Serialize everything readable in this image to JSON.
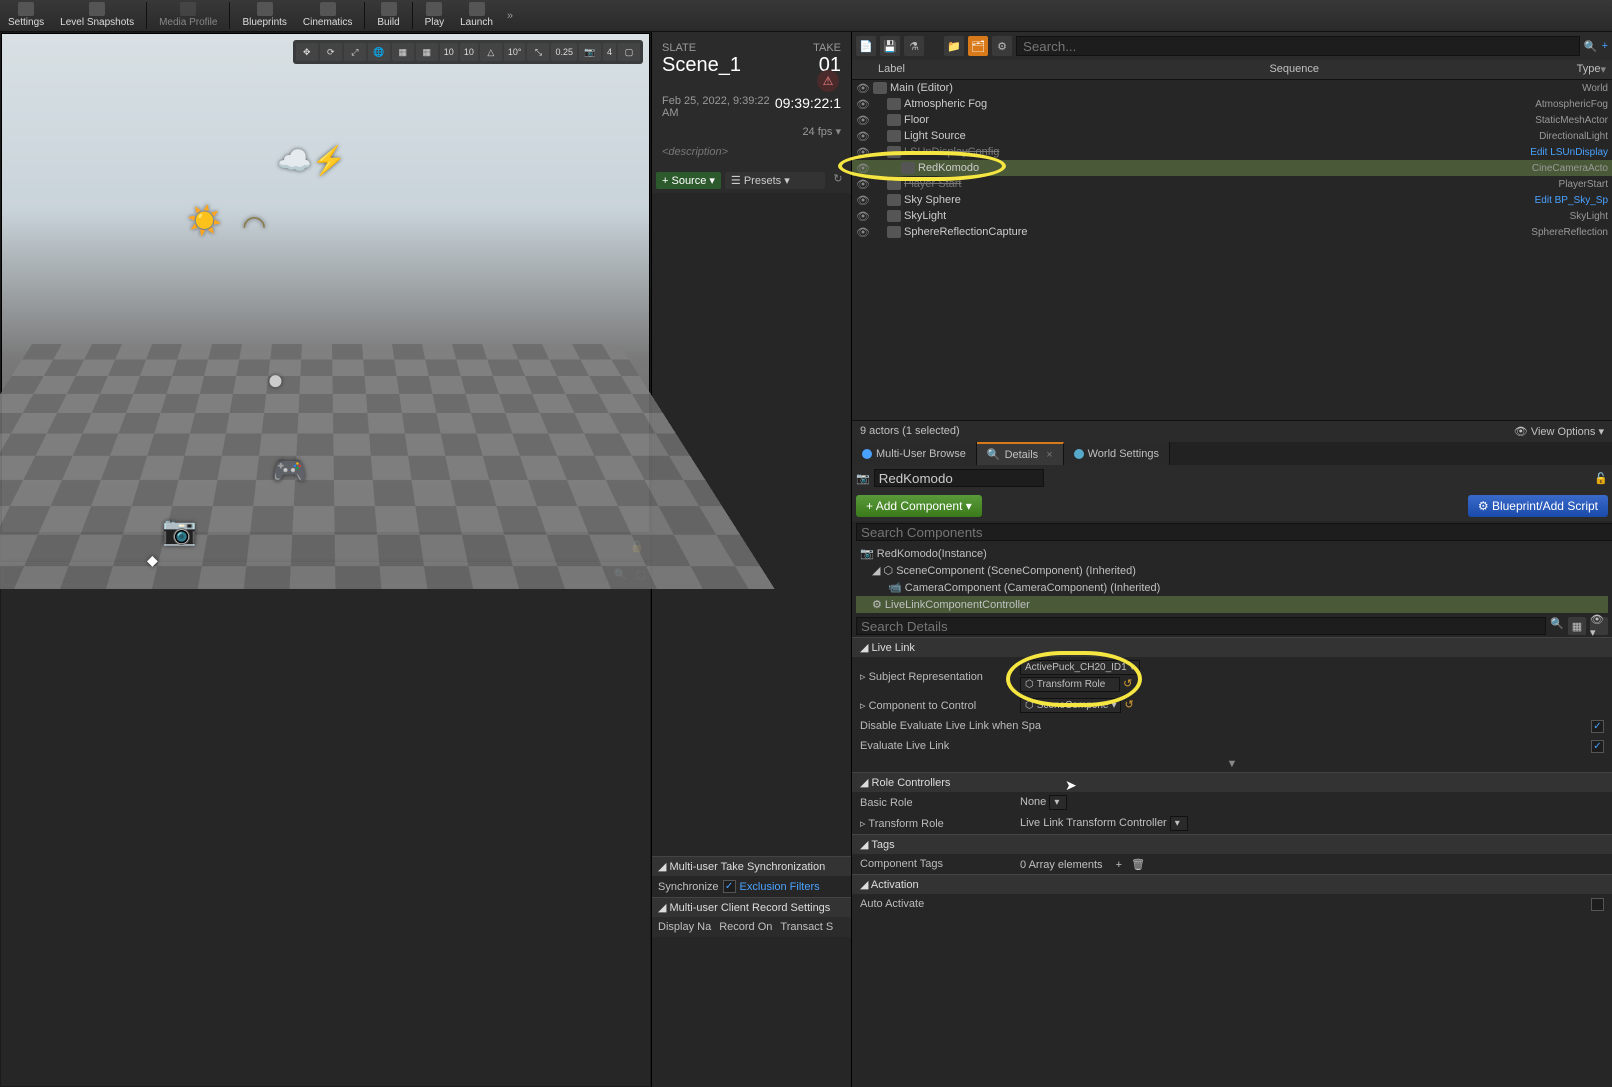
{
  "toolbar": {
    "settings": "Settings",
    "snapshots": "Level Snapshots",
    "media": "Media Profile",
    "blueprints": "Blueprints",
    "cinematics": "Cinematics",
    "build": "Build",
    "play": "Play",
    "launch": "Launch"
  },
  "viewport": {
    "snap1": "10",
    "snap2": "10",
    "snap3": "10°",
    "snap4": "0.25",
    "snap5": "4"
  },
  "slate": {
    "slate_label": "SLATE",
    "take_label": "TAKE",
    "scene": "Scene_1",
    "take": "01",
    "timestamp_text": "Feb 25, 2022, 9:39:22 AM",
    "timecode": "09:39:22:1",
    "fps": "24 fps",
    "description": "<description>",
    "source_btn": "Source",
    "presets_btn": "Presets"
  },
  "multiuser": {
    "sync_header": "Multi-user Take Synchronization",
    "sync_label": "Synchronize",
    "exclusion": "Exclusion Filters",
    "record_header": "Multi-user Client Record Settings",
    "col1": "Display Na",
    "col2": "Record On",
    "col3": "Transact S"
  },
  "outliner": {
    "search_placeholder": "Search...",
    "hdr_label": "Label",
    "hdr_seq": "Sequence",
    "hdr_type": "Type",
    "rows": [
      {
        "indent": 0,
        "name": "Main (Editor)",
        "type": "World"
      },
      {
        "indent": 1,
        "name": "Atmospheric Fog",
        "type": "AtmosphericFog"
      },
      {
        "indent": 1,
        "name": "Floor",
        "type": "StaticMeshActor"
      },
      {
        "indent": 1,
        "name": "Light Source",
        "type": "DirectionalLight"
      },
      {
        "indent": 1,
        "name": "LSUnDisplayConfig",
        "type": "Edit LSUnDisplay",
        "link": true,
        "strike": true
      },
      {
        "indent": 2,
        "name": "RedKomodo",
        "type": "CineCameraActo",
        "sel": true
      },
      {
        "indent": 1,
        "name": "Player Start",
        "type": "PlayerStart",
        "strike": true
      },
      {
        "indent": 1,
        "name": "Sky Sphere",
        "type": "Edit BP_Sky_Sp",
        "link": true
      },
      {
        "indent": 1,
        "name": "SkyLight",
        "type": "SkyLight"
      },
      {
        "indent": 1,
        "name": "SphereReflectionCapture",
        "type": "SphereReflection"
      }
    ],
    "footer_count": "9 actors (1 selected)",
    "view_options": "View Options"
  },
  "tabs": {
    "t1": "Multi-User Browse",
    "t2": "Details",
    "t3": "World Settings"
  },
  "details": {
    "actor_name": "RedKomodo",
    "add_component": "Add Component",
    "blueprint": "Blueprint/Add Script",
    "search_components": "Search Components",
    "comp_root": "RedKomodo(Instance)",
    "comp_scene": "SceneComponent (SceneComponent) (Inherited)",
    "comp_camera": "CameraComponent (CameraComponent) (Inherited)",
    "comp_livelink": "LiveLinkComponentController",
    "search_details": "Search Details",
    "cat_livelink": "Live Link",
    "subject_rep": "Subject Representation",
    "subject_val1": "ActivePuck_CH20_ID1",
    "subject_val2": "Transform Role",
    "component_control": "Component to Control",
    "component_val": "SceneCompone",
    "disable_eval": "Disable Evaluate Live Link when Spa",
    "evaluate": "Evaluate Live Link",
    "cat_roles": "Role Controllers",
    "basic_role": "Basic Role",
    "basic_role_val": "None",
    "transform_role": "Transform Role",
    "transform_role_val": "Live Link Transform Controller",
    "cat_tags": "Tags",
    "component_tags": "Component Tags",
    "tags_val": "0 Array elements",
    "cat_activation": "Activation",
    "auto_activate": "Auto Activate"
  }
}
